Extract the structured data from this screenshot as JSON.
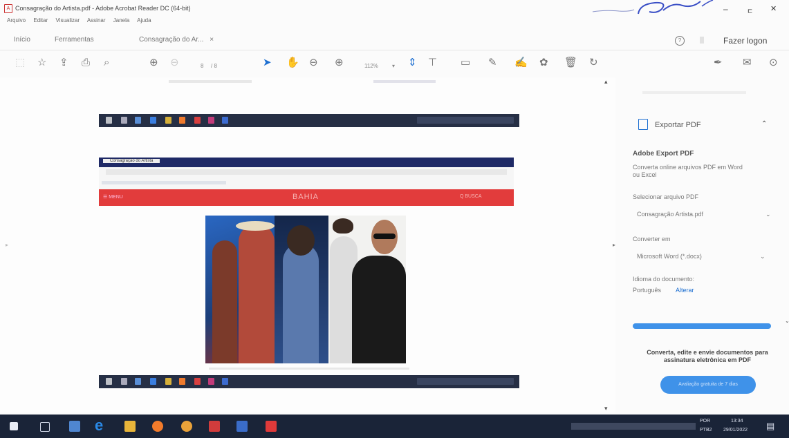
{
  "window": {
    "title": "Consagração do Artista.pdf - Adobe Acrobat Reader DC (64-bit)",
    "minimize": "–",
    "restore": "ㄷ",
    "close": "✕"
  },
  "menu": [
    "Arquivo",
    "Editar",
    "Visualizar",
    "Assinar",
    "Janela",
    "Ajuda"
  ],
  "tabs": {
    "home": "Início",
    "tools": "Ferramentas",
    "document": "Consagração do Ar...",
    "close_glyph": "×"
  },
  "header": {
    "help_glyph": "?",
    "login": "Fazer logon"
  },
  "toolbar": {
    "page_current": "8",
    "page_total": "/ 8",
    "zoom": "112%"
  },
  "document": {
    "browser_tab": "Consagração do Artista",
    "site_name": "BAHIA",
    "menu_label": "☰ MENU",
    "search_label": "Q BUSCA"
  },
  "right_panel": {
    "export_title": "Exportar PDF",
    "adobe_export_title": "Adobe Export PDF",
    "adobe_export_desc": "Converta online arquivos PDF em Word ou Excel",
    "select_file_label": "Selecionar arquivo PDF",
    "selected_file": "Consagração Artista.pdf",
    "convert_to_label": "Converter em",
    "convert_to_value": "Microsoft Word (*.docx)",
    "language_label": "Idioma do documento:",
    "language_value": "Português",
    "language_change": "Alterar",
    "promo_text": "Converta, edite e envie documentos para assinatura eletrônica em PDF",
    "trial_button": "Avaliação gratuita de 7 dias"
  },
  "taskbar": {
    "lang": "POR",
    "lang2": "PTB2",
    "time": "13:34",
    "date": "29/01/2022"
  },
  "colors": {
    "accent_blue": "#1d6fd1",
    "taskbar_bg": "#1a2438",
    "site_banner": "#e23c3c",
    "trial_button": "#3f92e9"
  }
}
